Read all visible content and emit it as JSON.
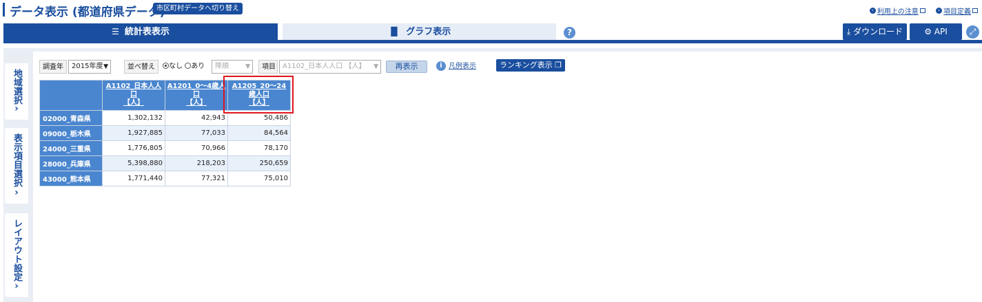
{
  "header": {
    "title": "データ表示 (都道府県データ)",
    "switch_button": "市区町村データへ切り替え",
    "links": [
      "利用上の注意",
      "項目定義"
    ]
  },
  "tabs": {
    "table": "統計表表示",
    "graph": "グラフ表示"
  },
  "actions": {
    "download": "ダウンロード",
    "api": "API"
  },
  "side_tabs": [
    "地域選択",
    "表示項目選択",
    "レイアウト設定"
  ],
  "toolbar": {
    "year_label": "調査年",
    "year_value": "2015年度",
    "sort_label": "並べ替え",
    "sort_none": "なし",
    "sort_some": "あり",
    "order_value": "降順",
    "item_label": "項目",
    "item_value": "A1102_日本人人口 【人】",
    "redisplay": "再表示",
    "legend": "凡例表示",
    "ranking": "ランキング表示"
  },
  "table": {
    "columns": [
      [
        "A1102_日本人人",
        "口",
        "【人】"
      ],
      [
        "A1201_0～4歳人",
        "口",
        "【人】"
      ],
      [
        "A1205_20～24",
        "歳人口",
        "【人】"
      ]
    ],
    "rows": [
      {
        "region": "02000_青森県",
        "values": [
          "1,302,132",
          "42,943",
          "50,486"
        ]
      },
      {
        "region": "09000_栃木県",
        "values": [
          "1,927,885",
          "77,033",
          "84,564"
        ]
      },
      {
        "region": "24000_三重県",
        "values": [
          "1,776,805",
          "70,966",
          "78,170"
        ]
      },
      {
        "region": "28000_兵庫県",
        "values": [
          "5,398,880",
          "218,203",
          "250,659"
        ]
      },
      {
        "region": "43000_熊本県",
        "values": [
          "1,771,440",
          "77,321",
          "75,010"
        ]
      }
    ]
  },
  "colors": {
    "primary": "#1a4e9e",
    "header_cell": "#4a86cf",
    "highlight": "#e0141e"
  }
}
